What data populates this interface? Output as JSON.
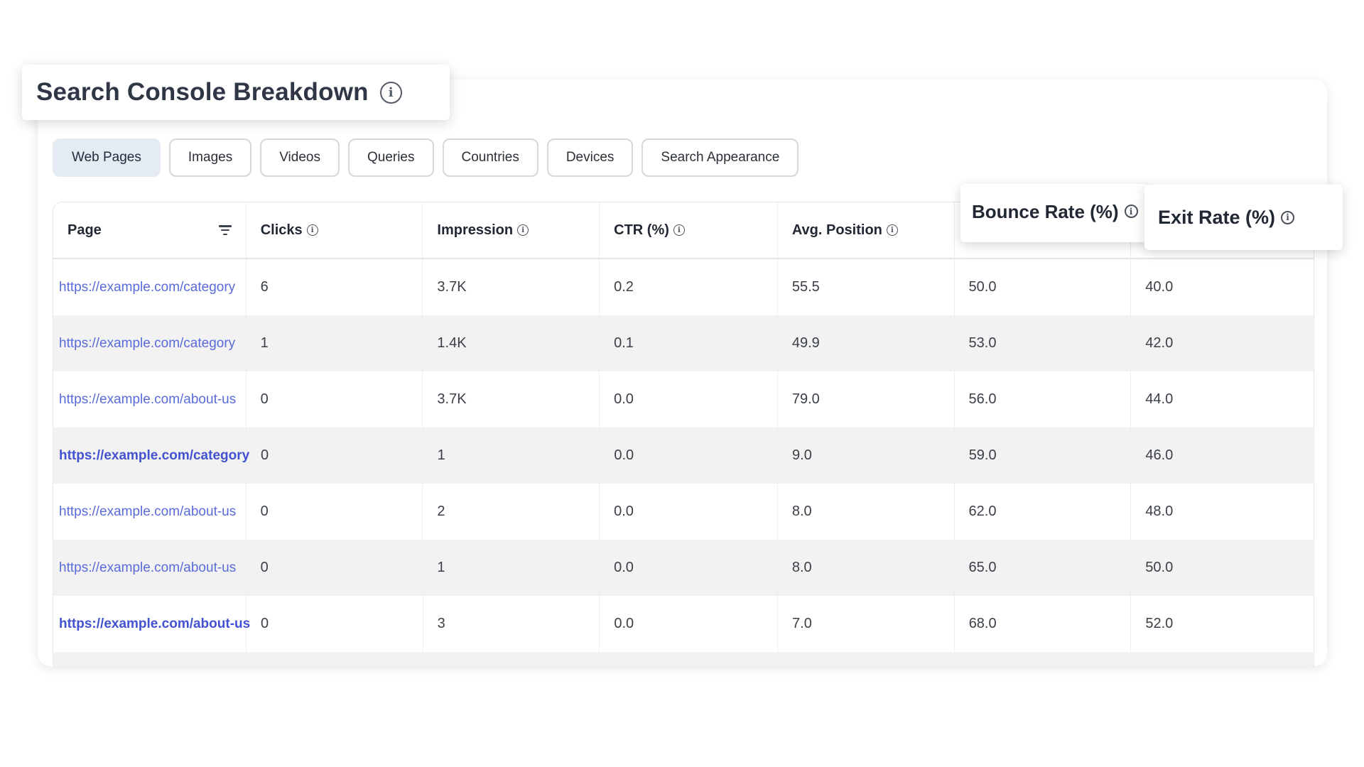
{
  "header": {
    "title": "Search Console Breakdown",
    "info_icon": "info-icon"
  },
  "tabs": [
    {
      "label": "Web Pages",
      "active": true
    },
    {
      "label": "Images",
      "active": false
    },
    {
      "label": "Videos",
      "active": false
    },
    {
      "label": "Queries",
      "active": false
    },
    {
      "label": "Countries",
      "active": false
    },
    {
      "label": "Devices",
      "active": false
    },
    {
      "label": "Search Appearance",
      "active": false
    }
  ],
  "table": {
    "columns": {
      "page": "Page",
      "clicks": "Clicks",
      "impression": "Impression",
      "ctr": "CTR (%)",
      "avg_position": "Avg. Position",
      "bounce_rate": "Bounce Rate (%)",
      "exit_rate": "Exit Rate (%)"
    },
    "rows": [
      {
        "page": "https://example.com/category",
        "clicks": "6",
        "impression": "3.7K",
        "ctr": "0.2",
        "avg_position": "55.5",
        "bounce_rate": "50.0",
        "exit_rate": "40.0"
      },
      {
        "page": "https://example.com/category",
        "clicks": "1",
        "impression": "1.4K",
        "ctr": "0.1",
        "avg_position": "49.9",
        "bounce_rate": "53.0",
        "exit_rate": "42.0"
      },
      {
        "page": "https://example.com/about-us",
        "clicks": "0",
        "impression": "3.7K",
        "ctr": "0.0",
        "avg_position": "79.0",
        "bounce_rate": "56.0",
        "exit_rate": "44.0"
      },
      {
        "page": "https://example.com/category",
        "clicks": "0",
        "impression": "1",
        "ctr": "0.0",
        "avg_position": "9.0",
        "bounce_rate": "59.0",
        "exit_rate": "46.0"
      },
      {
        "page": "https://example.com/about-us",
        "clicks": "0",
        "impression": "2",
        "ctr": "0.0",
        "avg_position": "8.0",
        "bounce_rate": "62.0",
        "exit_rate": "48.0"
      },
      {
        "page": "https://example.com/about-us",
        "clicks": "0",
        "impression": "1",
        "ctr": "0.0",
        "avg_position": "8.0",
        "bounce_rate": "65.0",
        "exit_rate": "50.0"
      },
      {
        "page": "https://example.com/about-us",
        "clicks": "0",
        "impression": "3",
        "ctr": "0.0",
        "avg_position": "7.0",
        "bounce_rate": "68.0",
        "exit_rate": "52.0"
      }
    ]
  },
  "colors": {
    "link": "#5a6ad8",
    "active_tab_bg": "#e4ebf3",
    "shaded_row_bg": "#f2f2f2",
    "title_text": "#2f3746"
  }
}
